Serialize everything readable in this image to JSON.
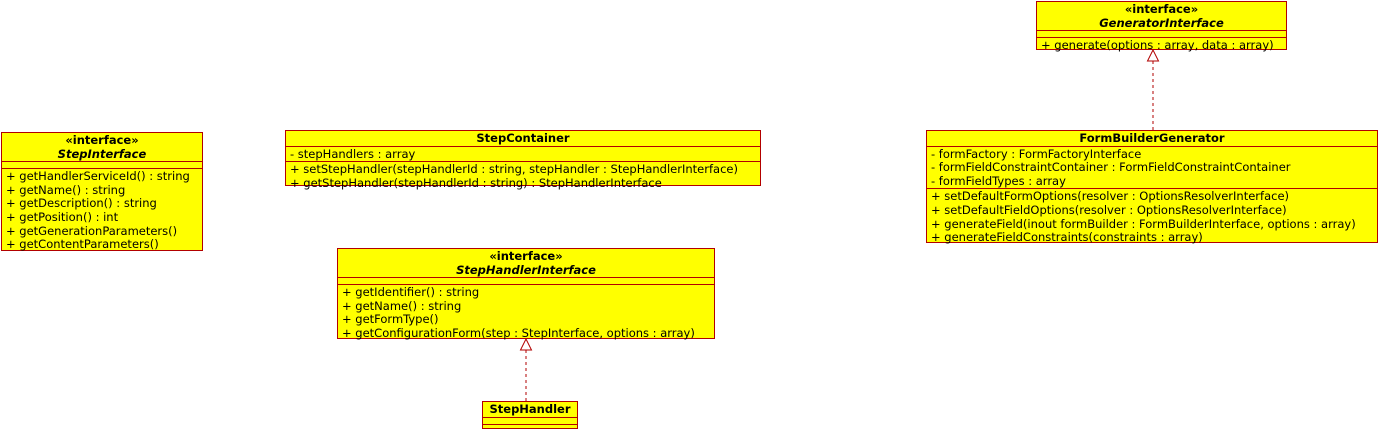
{
  "classes": {
    "generator_interface": {
      "stereotype": "«interface»",
      "name": "GeneratorInterface",
      "methods": [
        "+ generate(options : array, data : array)"
      ]
    },
    "step_interface": {
      "stereotype": "«interface»",
      "name": "StepInterface",
      "methods": [
        "+ getHandlerServiceId() : string",
        "+ getName() : string",
        "+ getDescription() : string",
        "+ getPosition() : int",
        "+ getGenerationParameters()",
        "+ getContentParameters()"
      ]
    },
    "step_container": {
      "name": "StepContainer",
      "attributes": [
        "- stepHandlers : array"
      ],
      "methods": [
        "+ setStepHandler(stepHandlerId : string, stepHandler : StepHandlerInterface)",
        "+ getStepHandler(stepHandlerId : string) : StepHandlerInterface"
      ]
    },
    "form_builder_generator": {
      "name": "FormBuilderGenerator",
      "attributes": [
        "- formFactory : FormFactoryInterface",
        "- formFieldConstraintContainer : FormFieldConstraintContainer",
        "- formFieldTypes : array"
      ],
      "methods": [
        "+ setDefaultFormOptions(resolver : OptionsResolverInterface)",
        "+ setDefaultFieldOptions(resolver : OptionsResolverInterface)",
        "+ generateField(inout formBuilder : FormBuilderInterface, options : array)",
        "+ generateFieldConstraints(constraints : array)"
      ]
    },
    "step_handler_interface": {
      "stereotype": "«interface»",
      "name": "StepHandlerInterface",
      "methods": [
        "+ getIdentifier() : string",
        "+ getName() : string",
        "+ getFormType()",
        "+ getConfigurationForm(step : StepInterface, options : array)"
      ]
    },
    "step_handler": {
      "name": "StepHandler"
    }
  },
  "colors": {
    "fill": "#ffff00",
    "border": "#b20000"
  }
}
